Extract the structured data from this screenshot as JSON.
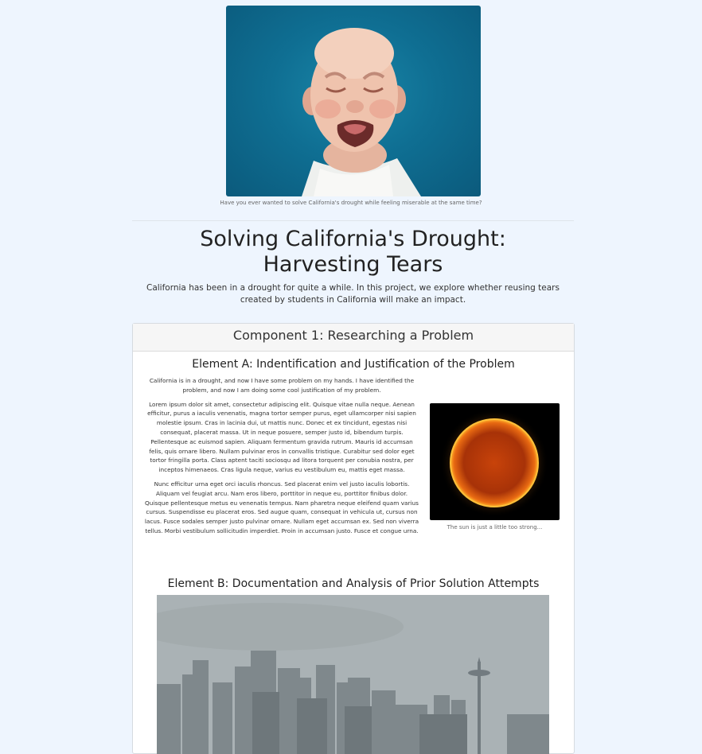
{
  "hero": {
    "image_name": "crying-baby-photo",
    "caption": "Have you ever wanted to solve California's drought while feeling miserable at the same time?"
  },
  "header": {
    "title_line1": "Solving California's Drought:",
    "title_line2": "Harvesting Tears",
    "lead": "California has been in a drought for quite a while. In this project, we explore whether reusing tears created by students in California will make an impact."
  },
  "component1": {
    "heading": "Component 1: Researching a Problem",
    "element_a": {
      "heading": "Element A: Indentification and Justification of the Problem",
      "intro": "California is in a drought, and now I have some problem on my hands. I have identified the problem, and now I am doing some cool justification of my problem.",
      "para1": "Lorem ipsum dolor sit amet, consectetur adipiscing elit. Quisque vitae nulla neque. Aenean efficitur, purus a iaculis venenatis, magna tortor semper purus, eget ullamcorper nisi sapien molestie ipsum. Cras in lacinia dui, ut mattis nunc. Donec et ex tincidunt, egestas nisi consequat, placerat massa. Ut in neque posuere, semper justo id, bibendum turpis. Pellentesque ac euismod sapien. Aliquam fermentum gravida rutrum. Mauris id accumsan felis, quis ornare libero. Nullam pulvinar eros in convallis tristique. Curabitur sed dolor eget tortor fringilla porta. Class aptent taciti sociosqu ad litora torquent per conubia nostra, per inceptos himenaeos. Cras ligula neque, varius eu vestibulum eu, mattis eget massa.",
      "para2": "Nunc efficitur urna eget orci iaculis rhoncus. Sed placerat enim vel justo iaculis lobortis. Aliquam vel feugiat arcu. Nam eros libero, porttitor in neque eu, porttitor finibus dolor. Quisque pellentesque metus eu venenatis tempus. Nam pharetra neque eleifend quam varius cursus. Suspendisse eu placerat eros. Sed augue quam, consequat in vehicula ut, cursus non lacus. Fusce sodales semper justo pulvinar ornare. Nullam eget accumsan ex. Sed non viverra tellus. Morbi vestibulum sollicitudin imperdiet. Proin in accumsan justo. Fusce et congue urna.",
      "image_name": "sun-photo",
      "image_caption": "The sun is just a little too strong..."
    },
    "element_b": {
      "heading": "Element B: Documentation and Analysis of Prior Solution Attempts",
      "image_name": "rainy-city-skyline-photo"
    }
  }
}
